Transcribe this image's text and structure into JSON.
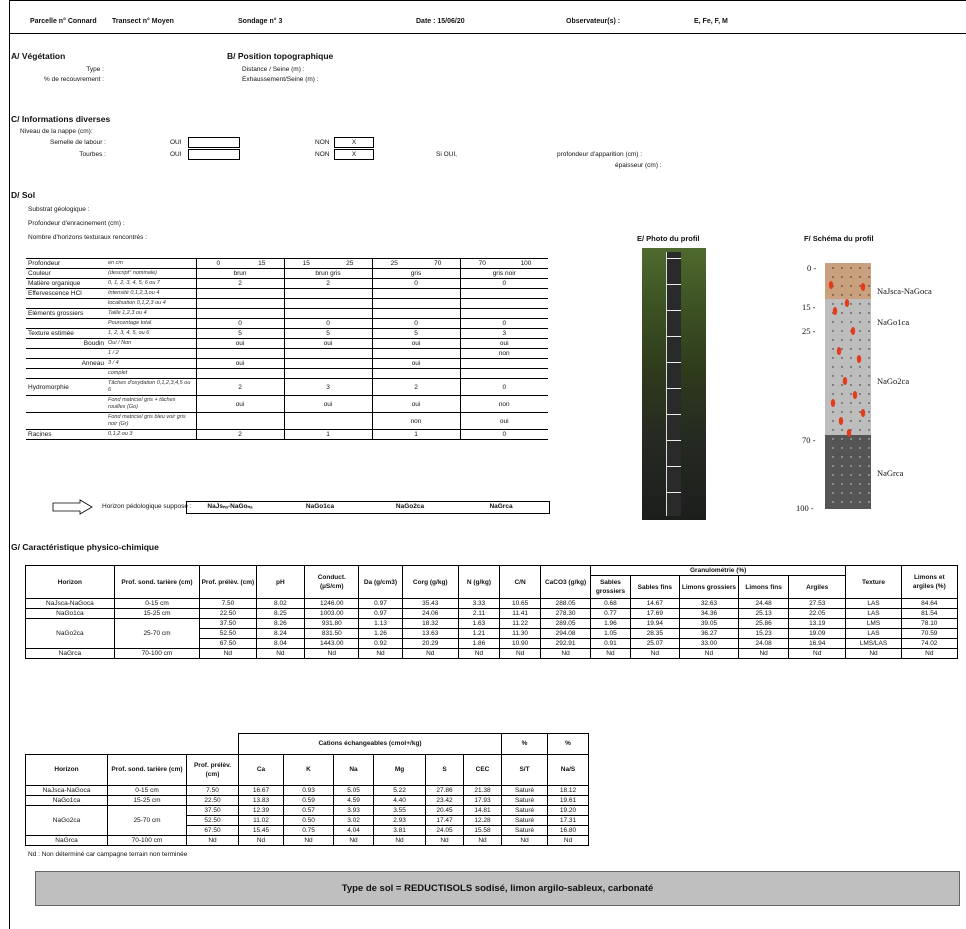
{
  "header": {
    "parcelle": "Parcelle n° Connard",
    "transect": "Transect n° Moyen",
    "sondage": "Sondage n° 3",
    "date": "Date : 15/06/20",
    "observateur_label": "Observateur(s) :",
    "observateurs": "E, Fe, F, M"
  },
  "vegetation": {
    "title": "A/  Végétation",
    "type_label": "Type :",
    "recouvrement_label": "% de recouvrement :"
  },
  "topo": {
    "title": "B/  Position topographique",
    "distance_label": "Distance / Seine (m) :",
    "exhaussement_label": "Exhaussement/Seine (m) :"
  },
  "infos": {
    "title": "C/  Informations diverses",
    "nappe_label": "Niveau de la nappe (cm):",
    "semelle_label": "Semelle de labour :",
    "tourbes_label": "Tourbes :",
    "oui": "OUI",
    "non": "NON",
    "semelle_non_value": "X",
    "tourbes_non_value": "X",
    "si_oui": "Si OUI,",
    "profondeur_apparition": "profondeur d'apparition (cm) :",
    "epaisseur": "épaisseur (cm) :"
  },
  "sol": {
    "title": "D/  Sol",
    "substrat": "Substrat géologique :",
    "enracinement": "Profondeur d'enracinement (cm) :",
    "nb_horizons": "Nombre d'horizons texturaux rencontrés :",
    "horizon_suppose_label": "Horizon pédologique supposé :",
    "horizons_supposes": [
      "NaJsₙₐ-NaGoₙₐ",
      "NaGo1ca",
      "NaGo2ca",
      "NaGrca"
    ],
    "rows": [
      {
        "label": "Profondeur",
        "hint": "en cm",
        "vals": [
          "0",
          "15",
          "15",
          "25",
          "25",
          "70",
          "70",
          "100"
        ]
      },
      {
        "label": "Couleur",
        "hint": "(descript° nominale)",
        "vals": [
          "brun",
          "brun gris",
          "gris",
          "gris noir"
        ]
      },
      {
        "label": "Matière organique",
        "hint": "0, 1, 2, 3, 4, 5, 6 ou 7",
        "vals": [
          "2",
          "2",
          "0",
          "0"
        ]
      },
      {
        "label": "Effervescence HCl",
        "hint": "Intensité 0,1,2,3,ou 4",
        "vals": [
          "",
          "",
          "",
          ""
        ]
      },
      {
        "label": "",
        "hint": "localisation 0,1,2,3 ou 4",
        "vals": [
          "",
          "",
          "",
          ""
        ]
      },
      {
        "label": "Eléments grossiers",
        "hint": "Taille 1,2,3 ou 4",
        "vals": [
          "",
          "",
          "",
          ""
        ]
      },
      {
        "label": "",
        "hint": "Pourcentage total",
        "vals": [
          "0",
          "0",
          "0",
          "0"
        ]
      },
      {
        "label": "Texture estimée",
        "hint": "1, 2, 3, 4, 5, ou 6",
        "vals": [
          "5",
          "5",
          "5",
          "3"
        ]
      },
      {
        "label": "Boudin",
        "hint": "Oui / Non",
        "vals": [
          "oui",
          "oui",
          "oui",
          "oui"
        ]
      },
      {
        "label": "",
        "hint": "1 / 2",
        "vals": [
          "",
          "",
          "",
          "non"
        ]
      },
      {
        "label": "Anneau",
        "hint": "3 / 4",
        "vals": [
          "oui",
          "",
          "oui",
          ""
        ]
      },
      {
        "label": "",
        "hint": "complet",
        "vals": [
          "",
          "",
          "",
          ""
        ]
      },
      {
        "label": "Hydromorphie",
        "hint": "Tâches d'oxydation 0,1,2,3,4,5 ou 6",
        "vals": [
          "2",
          "3",
          "2",
          "0"
        ]
      },
      {
        "label": "",
        "hint": "Fond matriciel gris + tâches rouilles (Go)",
        "vals": [
          "oui",
          "oui",
          "oui",
          "non"
        ]
      },
      {
        "label": "",
        "hint": "Fond matriciel gris bleu voir gris noir (Gr)",
        "vals": [
          "",
          "",
          "non",
          "oui"
        ]
      },
      {
        "label": "Racines",
        "hint": "0,1,2 ou 3",
        "vals": [
          "2",
          "1",
          "1",
          "0"
        ]
      }
    ]
  },
  "photo": {
    "title": "E/ Photo du profil"
  },
  "schema": {
    "title": "F/ Schéma du profil",
    "depths": [
      "0 -",
      "15 -",
      "25 -",
      "70 -",
      "100 -"
    ],
    "horizons": [
      "NaJsca-NaGoca",
      "NaGo1ca",
      "NaGo2ca",
      "NaGrca"
    ],
    "colors": [
      "#c9a17e",
      "#bdbdbd",
      "#bdbdbd",
      "#555555"
    ]
  },
  "physico": {
    "title": "G/ Caractéristique physico-chimique",
    "headers": [
      "Horizon",
      "Prof. sond. tarière (cm)",
      "Prof. prélèv. (cm)",
      "pH",
      "Conduct. (µS/cm)",
      "Da (g/cm3)",
      "Corg (g/kg)",
      "N (g/kg)",
      "C/N",
      "CaCO3 (g/kg)",
      "Sables grossiers",
      "Sables fins",
      "Limons grossiers",
      "Limons fins",
      "Argiles",
      "Texture",
      "Limons et argiles (%)"
    ],
    "granulo_header": "Granulométrie (%)",
    "rows": [
      [
        "NaJsca-NaGoca",
        "0-15 cm",
        "7.50",
        "8.02",
        "1246.00",
        "0.97",
        "35.43",
        "3.33",
        "10.65",
        "288.05",
        "0.68",
        "14.67",
        "32.63",
        "24.48",
        "27.53",
        "LAS",
        "84.64"
      ],
      [
        "NaGo1ca",
        "15-25 cm",
        "22.50",
        "8.25",
        "1003.00",
        "0.97",
        "24.06",
        "2.11",
        "11.41",
        "278.30",
        "0.77",
        "17.69",
        "34.36",
        "25.13",
        "22.05",
        "LAS",
        "81.54"
      ],
      [
        "NaGo2ca",
        "25-70 cm",
        "37.50",
        "8.26",
        "931.80",
        "1.13",
        "18.32",
        "1.63",
        "11.22",
        "289.05",
        "1.96",
        "19.94",
        "39.05",
        "25.86",
        "13.19",
        "LMS",
        "78.10"
      ],
      [
        "",
        "",
        "52.50",
        "8.24",
        "831.50",
        "1.26",
        "13.63",
        "1.21",
        "11.30",
        "294.08",
        "1.05",
        "28.35",
        "36.27",
        "15.23",
        "19.09",
        "LAS",
        "70.59"
      ],
      [
        "",
        "",
        "67.50",
        "8.04",
        "1443.00",
        "0.92",
        "20.29",
        "1.86",
        "10.90",
        "292.91",
        "0.91",
        "25.07",
        "33.00",
        "24.08",
        "16.94",
        "LMS/LAS",
        "74.02"
      ],
      [
        "NaGrca",
        "70-100 cm",
        "Nd",
        "Nd",
        "Nd",
        "Nd",
        "Nd",
        "Nd",
        "Nd",
        "Nd",
        "Nd",
        "Nd",
        "Nd",
        "Nd",
        "Nd",
        "Nd",
        "Nd"
      ]
    ]
  },
  "cations": {
    "group_header": "Cations échangeables (cmol+/kg)",
    "pct": "%",
    "headers": [
      "Horizon",
      "Prof. sond. tarière (cm)",
      "Prof. prélèv. (cm)",
      "Ca",
      "K",
      "Na",
      "Mg",
      "S",
      "CEC",
      "S/T",
      "Na/S"
    ],
    "rows": [
      [
        "NaJsca-NaGoca",
        "0-15 cm",
        "7.50",
        "16.67",
        "0.93",
        "5.05",
        "5.22",
        "27.86",
        "21.38",
        "Saturé",
        "18.12"
      ],
      [
        "NaGo1ca",
        "15-25 cm",
        "22.50",
        "13.83",
        "0.59",
        "4.59",
        "4.40",
        "23.42",
        "17.93",
        "Saturé",
        "19.61"
      ],
      [
        "NaGo2ca",
        "25-70 cm",
        "37.50",
        "12.39",
        "0.57",
        "3.93",
        "3.55",
        "20.45",
        "14.81",
        "Saturé",
        "19.20"
      ],
      [
        "",
        "",
        "52.50",
        "11.02",
        "0.50",
        "3.02",
        "2.93",
        "17.47",
        "12.28",
        "Saturé",
        "17.31"
      ],
      [
        "",
        "",
        "67.50",
        "15.45",
        "0.75",
        "4.04",
        "3.81",
        "24.05",
        "15.58",
        "Saturé",
        "16.80"
      ],
      [
        "NaGrca",
        "70-100 cm",
        "Nd",
        "Nd",
        "Nd",
        "Nd",
        "Nd",
        "Nd",
        "Nd",
        "Nd",
        "Nd"
      ]
    ],
    "note": "Nd : Non déterminé car campagne terrain non terminée"
  },
  "conclusion": "Type de sol = REDUCTISOLS sodisé, limon argilo-sableux, carbonaté"
}
